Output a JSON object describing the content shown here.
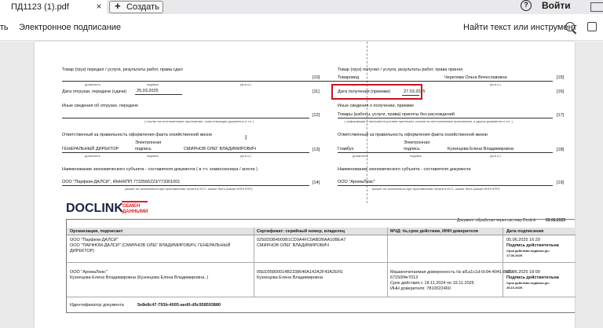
{
  "browser": {
    "tab_title": "ПД1123 (1).pdf",
    "tab_close": "×",
    "new_tab_plus": "+",
    "new_tab_label": "Создать",
    "help_glyph": "?",
    "sign_in": "Войти"
  },
  "toolbar": {
    "left_truncated": "ать",
    "e_sign": "Электронное подписание",
    "find": "Найти текст или инструмент"
  },
  "doc": {
    "left": {
      "transfer_label": "Товар (груз) передал / услуги, результаты работ, права сдал",
      "n10": "[10]",
      "sub_dolzh": "должность",
      "sub_podp": "подпись",
      "sub_fio": "(ф.и.о.)",
      "ship_label": "Дата отгрузки, передачи (сдачи)",
      "ship_date": "25.03.2025",
      "n11": "[11]",
      "other_label": "Иные сведения об отгрузке, передаче",
      "n12": "[12]",
      "other_sub": "( ссылки на неотъемлемые приложения, сопутствующие документы и т.п. )",
      "resp_label": "Ответственный за правильность оформления факта хозяйственной жизни",
      "resp_pos": "ГЕНЕРАЛЬНЫЙ ДИРЕКТОР",
      "resp_sig1": "Электронная",
      "resp_sig2": "подпись",
      "resp_name": "СМИРНОВ ОЛЕГ ВЛАДИМИРОВИЧ",
      "n13": "[13]",
      "entity_label": "Наименование экономического субъекта - составителя документа ( в т.ч. комиссионера / агента )",
      "entity_value": "ООО \"Парфюм-ДАЛСИ\", ИНН/КПП 7733566223/773301001",
      "n14": "[14]",
      "entity_sub": "(может не заполняться при проставлении печати в М.П., может быть указан ИНН/ КПП)"
    },
    "right": {
      "recv_label": "Товар (груз) получил / услуги, результаты работ, права принял",
      "recv_pos": "Товаровед",
      "recv_name": "Черепова  Ольга  Вячеславовна",
      "n15": "[15]",
      "sub_dolzh": "должность",
      "sub_podp": "подпись",
      "sub_fio": "(ф.и.о.)",
      "recv_date_label": "Дата получения (приемки)",
      "recv_date": "27.03.2025",
      "n16": "[16]",
      "other_label": "Иные сведения о получении, приемке",
      "other_value": "Товары (работы, услуги, права) приняты без расхождений",
      "n17": "[17]",
      "other_sub": "( информация о наличии/отсутствии претензии; ссылки на неотъемлемые приложения, и другие  документы и т.п. )",
      "resp_label": "Ответственный за правильность оформления факта хозяйственной жизни",
      "resp_pos": "Главбух",
      "resp_sig1": "Электронная",
      "resp_sig2": "подпись",
      "resp_name": "Кузнецова Елена Владимировна",
      "n18": "[18]",
      "entity_label": "Наименование экономического субъекта - составителя документа",
      "entity_value": "ООО \"АромаЛюкс\"",
      "n19": "[19]",
      "entity_sub": "(может не заполняться при проставлении печати в М.П., может быть указан ИНН/ КПП)"
    }
  },
  "stamp": {
    "logo_word": "DOCLINK",
    "logo_tag1": "ОБМЕН",
    "logo_tag2": "ДАННЫМИ",
    "processed_text": "Документ обработан через систему Doclink",
    "processed_date": "05.06.2025",
    "headers": [
      "Организация, подписант",
      "Сертификат: серийный номер, владелец",
      "МЧД: №,срок действия, ИНН доверителя",
      "Дата подписания"
    ],
    "row1": {
      "org_l1": "ООО \"Парфюм-ДАЛСИ\"",
      "org_l2": "ООО \"ПАРФЮМ-ДАЛСИ\" (СМИРНОВ ОЛЕГ ВЛАДИМИРОВИЧ, ГЕНЕРАЛЬНЫЙ",
      "org_l3": "ДИРЕКТОР)",
      "cert_l1": "0250DDB4009B1CD9A4FC0ABDBAA10BEA7",
      "cert_l2": "СМИРНОВ ОЛЕГ ВЛАДИМИРОВИЧ",
      "date": "05.06.2025 16:29",
      "date_sub": "Подпись действительна",
      "valid_l1": "Срок действия подписи до:",
      "valid_l2": "17.06.2025"
    },
    "row2": {
      "org_l1": "ООО \"АромаЛюкс\"",
      "org_l2": "Кузнецова Елена Владимировна (Кузнецова Елена Владимировна, )",
      "cert_l1": "05ED05800014B2338640A142A2F43A2EFE",
      "cert_l2": "Кузнецова Елена Владимировна",
      "mchd_l1": "Машиночитаемая доверенность № af1a1c1d-0c94-4041-8b19-",
      "mchd_l2": "67150f4e7013",
      "mchd_l3": "Срок действия с 18.11.2024 по 19.11.2025",
      "mchd_l4": "ИНН доверителя: 7810022460",
      "date": "05.06.2025 18:00",
      "date_sub": "Подпись действительна",
      "valid_l1": "Срок действия подписи до:",
      "valid_l2": "25.10.2025"
    },
    "doc_id_label": "Идентификатор документа",
    "doc_id": "5e8e8c47-793b-4005-aed0-d9c958593880"
  }
}
